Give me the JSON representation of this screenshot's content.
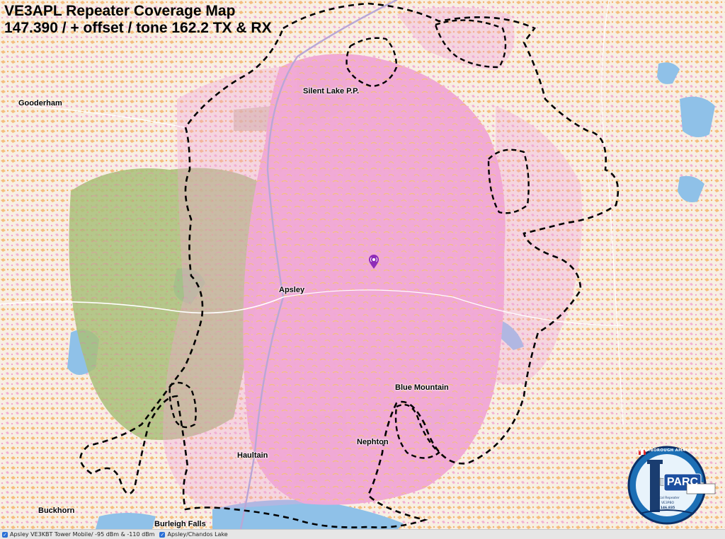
{
  "title": {
    "line1": "VE3APL Repeater Coverage Map",
    "line2": "147.390 / + offset / tone 162.2 TX & RX"
  },
  "places": [
    {
      "id": "silent-lake",
      "label": "Silent Lake P.P."
    },
    {
      "id": "gooderham",
      "label": "Gooderham"
    },
    {
      "id": "apsley",
      "label": "Apsley"
    },
    {
      "id": "blue-mountain",
      "label": "Blue Mountain"
    },
    {
      "id": "nephton",
      "label": "Nephton"
    },
    {
      "id": "haultain",
      "label": "Haultain"
    },
    {
      "id": "buckhorn",
      "label": "Buckhorn"
    },
    {
      "id": "burleigh-falls",
      "label": "Burleigh Falls"
    }
  ],
  "legend": {
    "layer1": "Apsley VE3KBT Tower Mobile/ -95 dBm & -110 dBm",
    "layer2": "Apsley/Chandos Lake"
  },
  "logo": {
    "club": "PETERBOROUGH AMATEUR RADIO CLUB",
    "short": "PARC",
    "sub": "Local Repeater",
    "call": "VE3PBO",
    "freq": "146.835"
  },
  "colors": {
    "coverage_strong": "#f2a7d8",
    "coverage_weak": "#f7b26a",
    "park_green": "#9fbf73",
    "water": "#8fc1e8",
    "land": "#f6efe6",
    "marker": "#8e2cb8",
    "boundary": "#000000"
  },
  "icons": {
    "marker": "repeater-location-icon",
    "checkbox": "checkbox-checked-icon"
  }
}
